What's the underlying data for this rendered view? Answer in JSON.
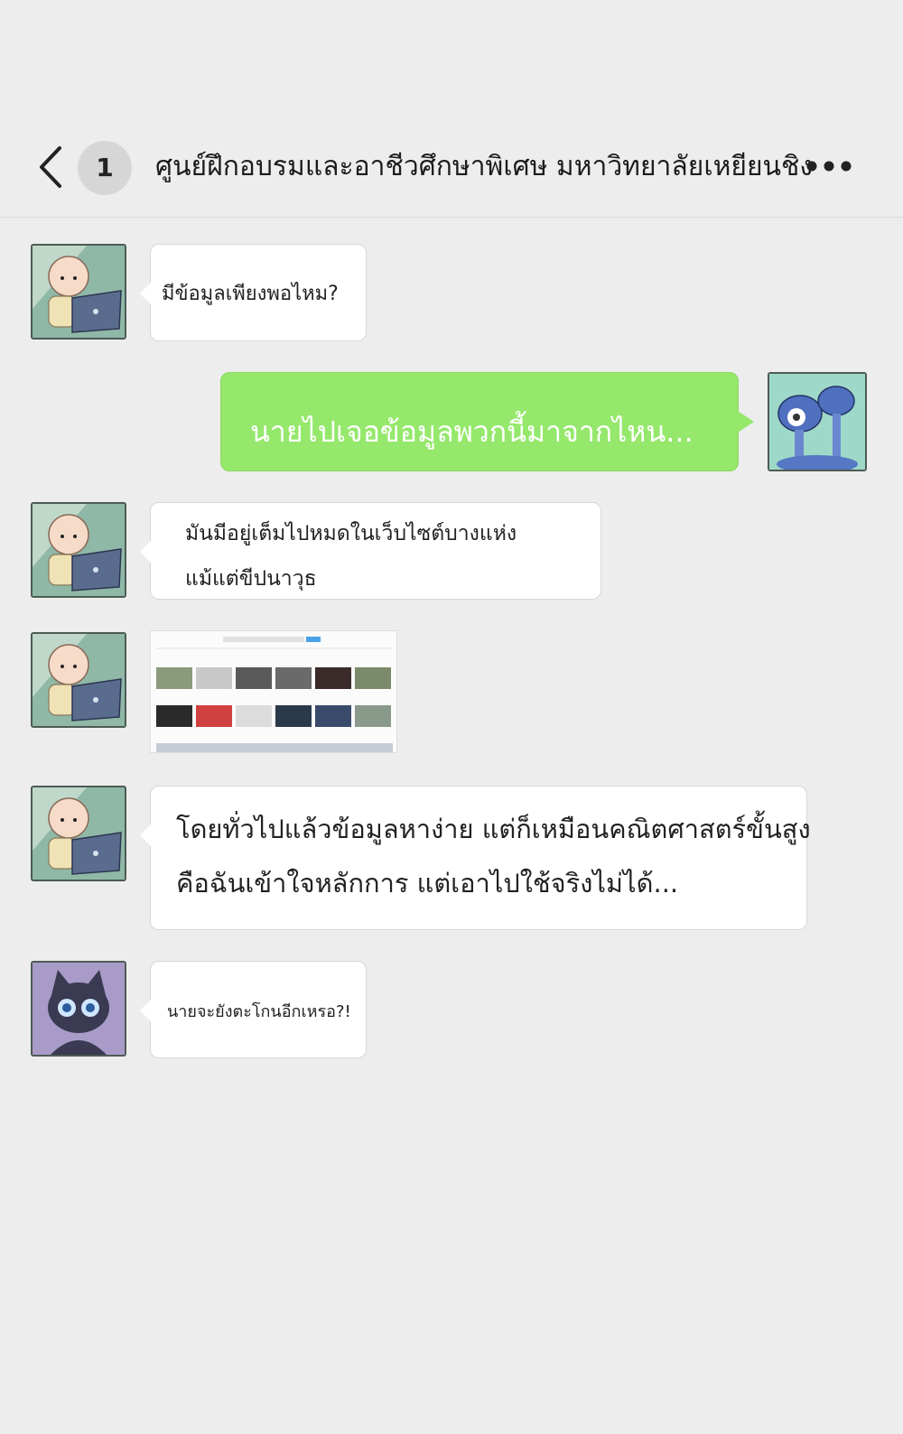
{
  "header": {
    "back_icon": "chevron-left-icon",
    "unread_count": "1",
    "title": "ศูนย์ฝึกอบรมและอาชีวศึกษาพิเศษ มหาวิทยาลัยเหยียนชิง",
    "more_icon": "more-horizontal-icon"
  },
  "messages": [
    {
      "sender": "other",
      "avatar": "baby-laptop-avatar",
      "text": "มีข้อมูลเพียงพอไหม?"
    },
    {
      "sender": "self",
      "avatar": "mushroom-eyes-avatar",
      "text": "นายไปเจอข้อมูลพวกนี้มาจากไหน..."
    },
    {
      "sender": "other",
      "avatar": "baby-laptop-avatar",
      "lines": [
        "มันมีอยู่เต็มไปหมดในเว็บไซต์บางแห่ง",
        "แม้แต่ขีปนาวุธ"
      ]
    },
    {
      "sender": "other",
      "avatar": "baby-laptop-avatar",
      "image": "search-results-screenshot"
    },
    {
      "sender": "other",
      "avatar": "baby-laptop-avatar",
      "lines": [
        "โดยทั่วไปแล้วข้อมูลหาง่าย แต่ก็เหมือนคณิตศาสตร์ขั้นสูง",
        "คือฉันเข้าใจหลักการ แต่เอาไปใช้จริงไม่ได้..."
      ]
    },
    {
      "sender": "other",
      "avatar": "black-cat-avatar",
      "text": "นายจะยังตะโกนอีกเหรอ?!"
    }
  ],
  "colors": {
    "background": "#ededed",
    "self_bubble": "#95e86b",
    "other_bubble": "#ffffff"
  }
}
